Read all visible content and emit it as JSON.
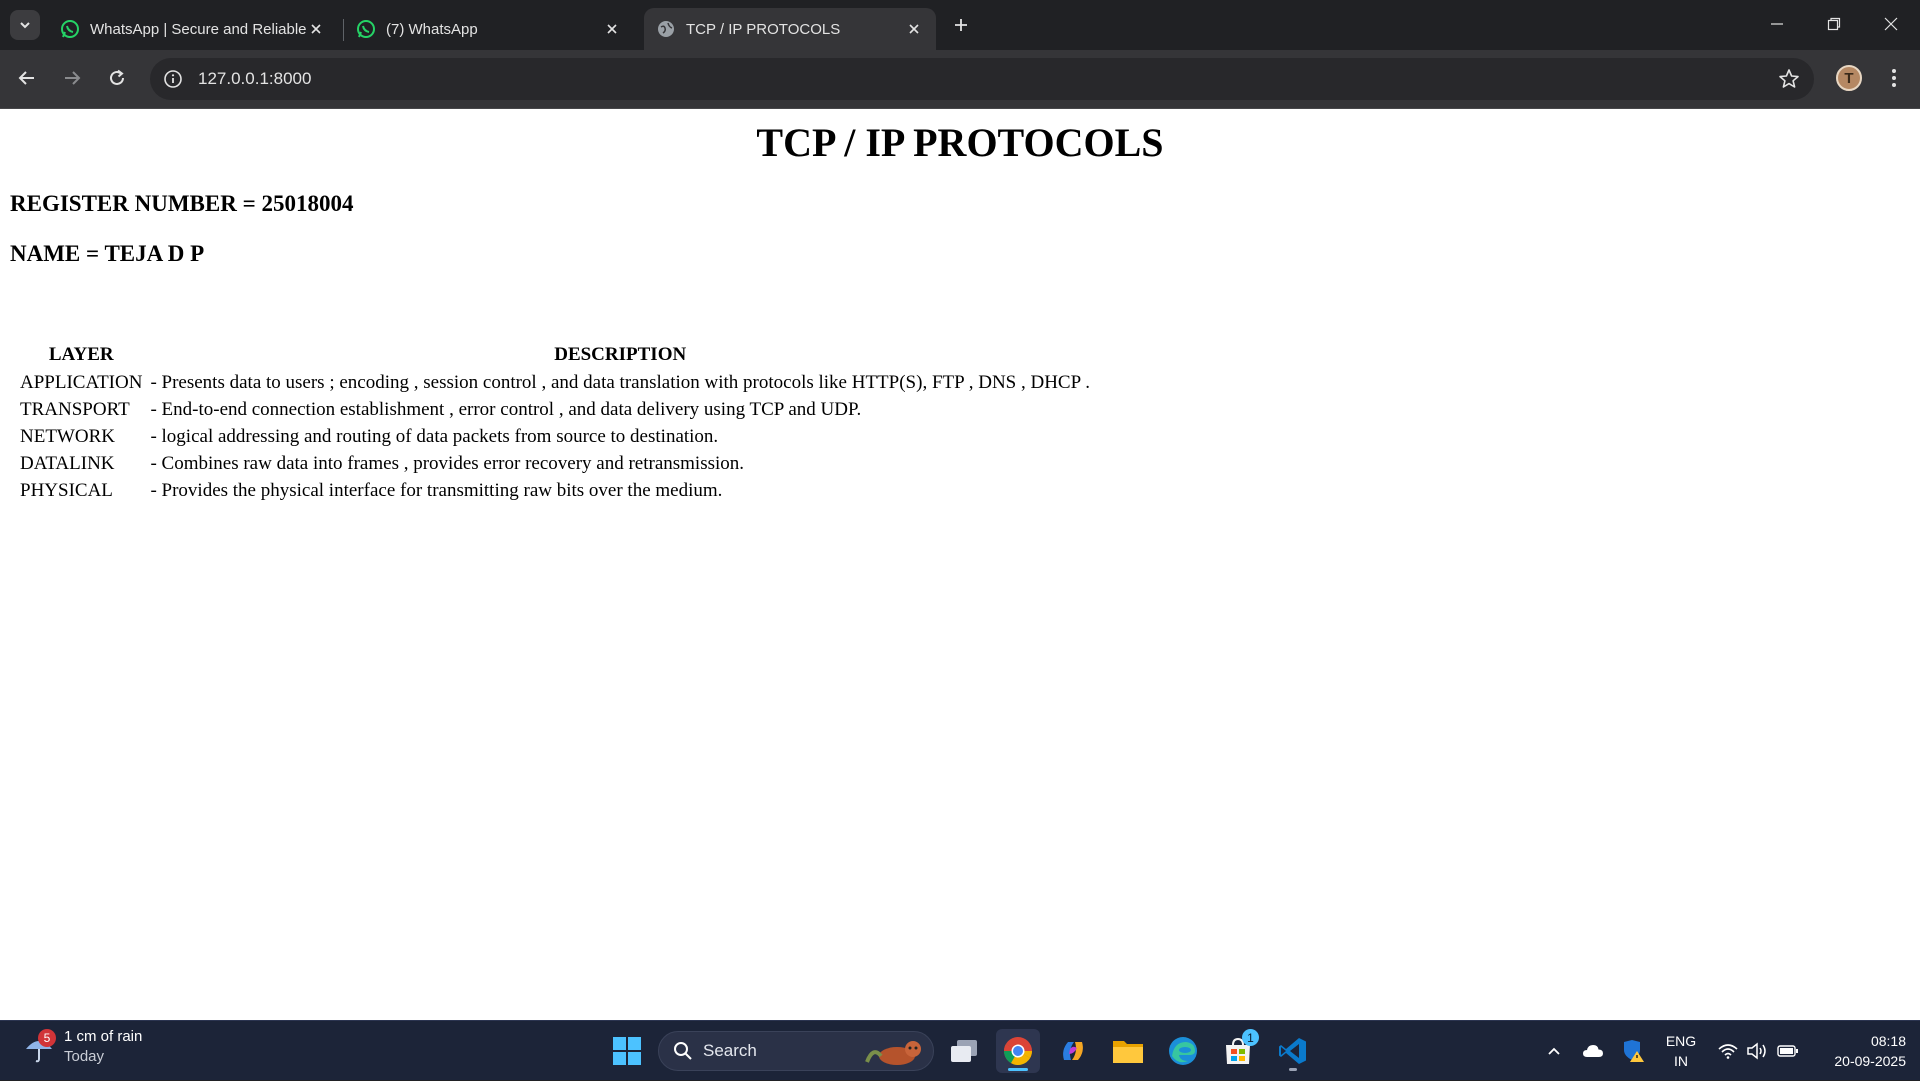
{
  "browser": {
    "tabs": [
      {
        "title": "WhatsApp | Secure and Reliable",
        "favicon": "whatsapp-icon",
        "active": false
      },
      {
        "title": "(7) WhatsApp",
        "favicon": "whatsapp-icon",
        "active": false
      },
      {
        "title": "TCP / IP PROTOCOLS",
        "favicon": "globe-icon",
        "active": true
      }
    ],
    "url": "127.0.0.1:8000",
    "profile_initial": "T"
  },
  "page": {
    "heading": "TCP / IP PROTOCOLS",
    "register_line": "REGISTER NUMBER = 25018004",
    "name_line": "NAME = TEJA D P",
    "table": {
      "headers": [
        "LAYER",
        "DESCRIPTION"
      ],
      "rows": [
        {
          "layer": "APPLICATION",
          "description": "- Presents data to users ; encoding , session control , and data translation with protocols like HTTP(S), FTP , DNS , DHCP ."
        },
        {
          "layer": "TRANSPORT",
          "description": "- End-to-end connection establishment , error control , and data delivery using TCP and UDP."
        },
        {
          "layer": "NETWORK",
          "description": "- logical addressing and routing of data packets from source to destination."
        },
        {
          "layer": "DATALINK",
          "description": "- Combines raw data into frames , provides error recovery and retransmission."
        },
        {
          "layer": "PHYSICAL",
          "description": "- Provides the physical interface for transmitting raw bits over the medium."
        }
      ]
    }
  },
  "taskbar": {
    "weather": {
      "badge": "5",
      "text": "1 cm of rain",
      "sub": "Today"
    },
    "search_label": "Search",
    "store_badge": "1",
    "language": {
      "line1": "ENG",
      "line2": "IN"
    },
    "time": "08:18",
    "date": "20-09-2025"
  },
  "colors": {
    "whatsapp": "#25d366",
    "accent_blue": "#4cc2ff",
    "page_bg": "#ffffff",
    "chrome_dark": "#202124"
  }
}
